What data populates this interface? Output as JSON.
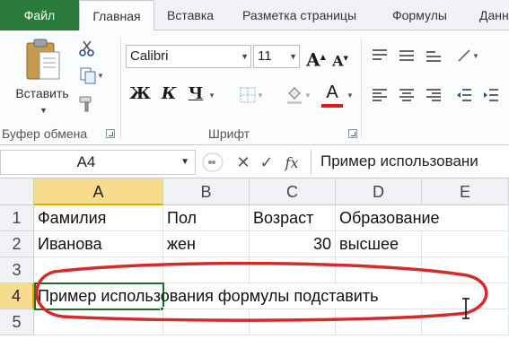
{
  "ribbon_tabs": [
    "Файл",
    "Главная",
    "Вставка",
    "Разметка страницы",
    "Формулы",
    "Данн"
  ],
  "clipboard": {
    "paste_label": "Вставить",
    "group_label": "Буфер обмена"
  },
  "font": {
    "name": "Calibri",
    "size": "11",
    "group_label": "Шрифт",
    "bold_label": "Ж",
    "italic_label": "К",
    "underline_label": "Ч",
    "color_letter": "A",
    "increase_label": "A",
    "decrease_label": "A",
    "font_color": "#e01b1b"
  },
  "formula_bar": {
    "name_box": "A4",
    "fx_label": "fx",
    "content": "Пример использовани"
  },
  "sheet": {
    "columns": [
      "A",
      "B",
      "C",
      "D",
      "E"
    ],
    "selected_column": "A",
    "rows": [
      "1",
      "2",
      "3",
      "4",
      "5"
    ],
    "selected_row": "4",
    "cells": {
      "A1": "Фамилия",
      "B1": "Пол",
      "C1": "Возраст",
      "D1": "Образование",
      "A2": "Иванова",
      "B2": "жен",
      "C2": "30",
      "D2": "высшее",
      "A4": "Пример использования формулы подставить"
    },
    "active_cell": "A4",
    "annotation_color": "#d42a2a"
  },
  "colors": {
    "file_tab": "#2a7a3c",
    "selection": "#f7dc8e",
    "accent": "#e0a800"
  }
}
